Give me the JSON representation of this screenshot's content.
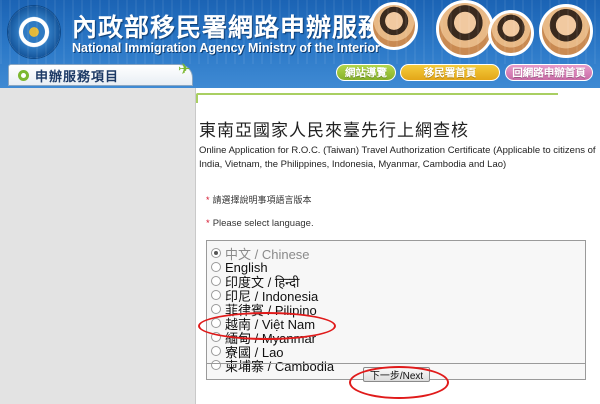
{
  "header": {
    "title_zh": "內政部移民署網路申辦服務",
    "title_en": "National Immigration Agency Ministry of the Interior"
  },
  "nav": {
    "service_items": "申辦服務項目",
    "site_map": "網站導覽",
    "nia_home": "移民署首頁",
    "apply_home": "回網路申辦首頁"
  },
  "page": {
    "title": "東南亞國家人民來臺先行上網查核",
    "subtitle": "Online Application for R.O.C. (Taiwan) Travel Authorization Certificate (Applicable to citizens of India, Vietnam, the Philippines, Indonesia, Myanmar, Cambodia and Lao)",
    "prompt_zh": "請選擇說明事項語言版本",
    "prompt_en": "Please select language.",
    "required_mark": "*",
    "next_button": "下一步/Next"
  },
  "languages": [
    {
      "label": "中文 / Chinese",
      "selected": true,
      "dim": true
    },
    {
      "label": "English",
      "selected": false,
      "dim": false
    },
    {
      "label": "印度文 / हिन्दी",
      "selected": false,
      "dim": false
    },
    {
      "label": "印尼 / Indonesia",
      "selected": false,
      "dim": false
    },
    {
      "label": "菲律賓 / Pilipino",
      "selected": false,
      "dim": false
    },
    {
      "label": "越南 / Việt Nam",
      "selected": false,
      "dim": false
    },
    {
      "label": "緬甸 / Myanmar",
      "selected": false,
      "dim": false
    },
    {
      "label": "寮國 / Lao",
      "selected": false,
      "dim": false
    },
    {
      "label": "柬埔寨 / Cambodia",
      "selected": false,
      "dim": false
    }
  ],
  "colors": {
    "header_blue": "#2c79c8",
    "accent_green": "#a9cf62",
    "highlight_red": "#e01a1a"
  }
}
